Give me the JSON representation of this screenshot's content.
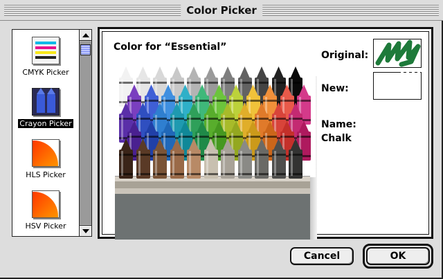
{
  "window": {
    "title": "Color Picker"
  },
  "pickers": [
    {
      "label": "CMYK Picker",
      "selected": false,
      "icon": "cmyk-icon"
    },
    {
      "label": "Crayon Picker",
      "selected": true,
      "icon": "crayon-icon"
    },
    {
      "label": "HLS Picker",
      "selected": false,
      "icon": "hls-wheel-icon"
    },
    {
      "label": "HSV Picker",
      "selected": false,
      "icon": "hsv-wheel-icon"
    }
  ],
  "main": {
    "color_for_label": "Color for “Essential”",
    "original_label": "Original:",
    "new_label": "New:",
    "name_label": "Name:",
    "name_value": "Chalk",
    "original_color": "#1e7a3a",
    "new_color": "#ffffff"
  },
  "crayons": {
    "row1": [
      "#f2f2f2",
      "#e6e6e6",
      "#d8d8d8",
      "#c8c8c8",
      "#b4b4b4",
      "#9a9a9a",
      "#7e7e7e",
      "#626262",
      "#444444",
      "#222222",
      "#0a0a0a"
    ],
    "row2": [
      "#7a3fbf",
      "#3f5fd6",
      "#3f8fe0",
      "#2fb0c8",
      "#3fb87a",
      "#6cc43c",
      "#bcd23a",
      "#f0c23a",
      "#f0903a",
      "#e85a4a",
      "#d43a8a"
    ],
    "row3": [
      "#5a2fa8",
      "#2f4fc0",
      "#2f7fd0",
      "#1f9ab0",
      "#2fa05a",
      "#58ad2c",
      "#a8bb2a",
      "#e0ae2a",
      "#e07a2a",
      "#d8443a",
      "#c42a72"
    ],
    "row4": [
      "#4a2090",
      "#2040a8",
      "#2068b8",
      "#108898",
      "#1f8a48",
      "#469820",
      "#94a820",
      "#cc9a1a",
      "#cc661a",
      "#c4302a",
      "#ae1a5e"
    ],
    "row5": [
      "#3a2418",
      "#5a3a26",
      "#7a5436",
      "#9a6a48",
      "#b88a66",
      "#c8c0b0",
      "#a8a298",
      "#8a8a86",
      "#6a6a66",
      "#4e4e4c",
      "#333332"
    ]
  },
  "buttons": {
    "cancel": "Cancel",
    "ok": "OK"
  }
}
